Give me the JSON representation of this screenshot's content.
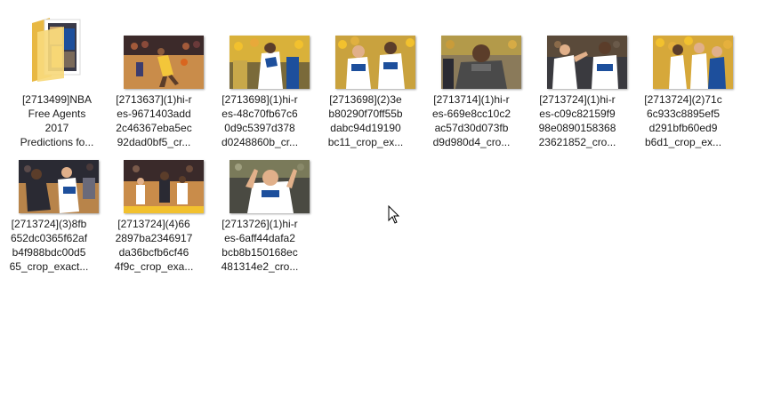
{
  "items": [
    {
      "kind": "folder",
      "icon": "folder-icon",
      "caption": "[2713499]NBA\nFree Agents\n2017\nPredictions fo..."
    },
    {
      "kind": "image",
      "icon": "image-thumbnail-icon",
      "caption": "[2713637](1)hi-r\nes-9671403add\n2c46367eba5ec\n92dad0bf5_cr..."
    },
    {
      "kind": "image",
      "icon": "image-thumbnail-icon",
      "caption": "[2713698](1)hi-r\nes-48c70fb67c6\n0d9c5397d378\nd0248860b_cr..."
    },
    {
      "kind": "image",
      "icon": "image-thumbnail-icon",
      "caption": "[2713698](2)3e\nb80290f70ff55b\ndabc94d19190\nbc11_crop_ex..."
    },
    {
      "kind": "image",
      "icon": "image-thumbnail-icon",
      "caption": "[2713714](1)hi-r\nes-669e8cc10c2\nac57d30d073fb\nd9d980d4_cro..."
    },
    {
      "kind": "image",
      "icon": "image-thumbnail-icon",
      "caption": "[2713724](1)hi-r\nes-c09c82159f9\n98e0890158368\n23621852_cro..."
    },
    {
      "kind": "image",
      "icon": "image-thumbnail-icon",
      "caption": "[2713724](2)71c\n6c933c8895ef5\nd291bfb60ed9\nb6d1_crop_ex..."
    },
    {
      "kind": "image",
      "icon": "image-thumbnail-icon",
      "caption": "[2713724](3)8fb\n652dc0365f62af\nb4f988bdc00d5\n65_crop_exact..."
    },
    {
      "kind": "image",
      "icon": "image-thumbnail-icon",
      "caption": "[2713724](4)66\n2897ba2346917\nda36bcfb6cf46\n4f9c_crop_exa..."
    },
    {
      "kind": "image",
      "icon": "image-thumbnail-icon",
      "caption": "[2713726](1)hi-r\nes-6aff44dafa2\nbcb8b150168ec\n481314e2_cro..."
    }
  ],
  "cursor": {
    "icon": "mouse-pointer-icon"
  },
  "colors": {
    "folder_back": "#e8b843",
    "folder_front": "#f7d97c",
    "caption_text": "#1a1a1a",
    "court_wood": "#c98c4a",
    "warriors_blue": "#1d4f9c",
    "warriors_gold": "#f2c12e",
    "cavs_dark": "#2a2a33",
    "lakers_gold": "#f3c63a"
  }
}
